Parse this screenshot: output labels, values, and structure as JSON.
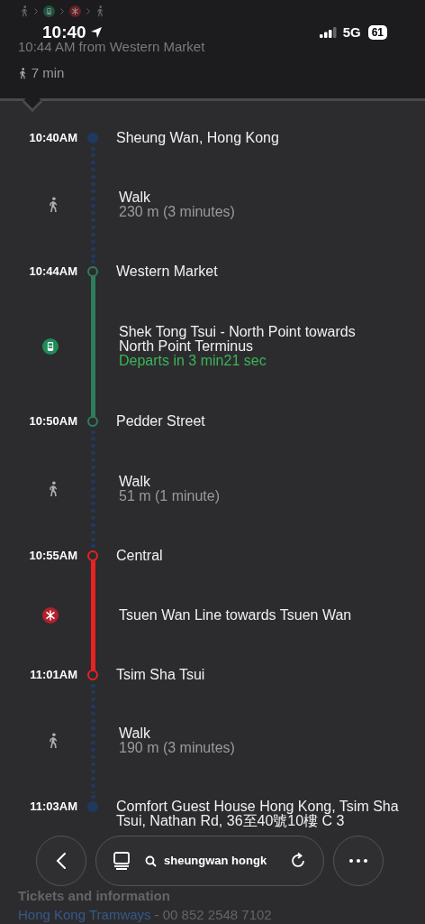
{
  "status_bar": {
    "time": "10:40",
    "network": "5G",
    "battery": "61"
  },
  "route_summary": {
    "modes": [
      {
        "kind": "walk"
      },
      {
        "kind": "tram"
      },
      {
        "kind": "mtr"
      },
      {
        "kind": "walk"
      }
    ],
    "departure": "10:44 AM from Western Market",
    "walk_time": "7 min"
  },
  "itinerary": [
    {
      "kind": "stop",
      "time": "10:40AM",
      "place": "Sheung Wan, Hong Kong"
    },
    {
      "kind": "walk",
      "color": "#1e3a5f",
      "title": "Walk",
      "detail": "230 m (3 minutes)"
    },
    {
      "kind": "stop",
      "time": "10:44AM",
      "place": "Western Market"
    },
    {
      "kind": "tram",
      "color": "#2e7d5b",
      "title": "Shek Tong Tsui - North Point towards North Point Terminus",
      "detail": "Departs in 3 min21 sec"
    },
    {
      "kind": "stop",
      "time": "10:50AM",
      "place": "Pedder Street"
    },
    {
      "kind": "walk",
      "color": "#1e3a5f",
      "title": "Walk",
      "detail": "51 m (1 minute)"
    },
    {
      "kind": "stop",
      "time": "10:55AM",
      "place": "Central"
    },
    {
      "kind": "mtr",
      "color": "#e8231f",
      "title": "Tsuen Wan Line towards Tsuen Wan"
    },
    {
      "kind": "stop",
      "time": "11:01AM",
      "place": "Tsim Sha Tsui"
    },
    {
      "kind": "walk",
      "color": "#1e3a5f",
      "title": "Walk",
      "detail": "190 m (3 minutes)"
    },
    {
      "kind": "stop",
      "time": "11:03AM",
      "place": "Comfort Guest House Hong Kong, Tsim Sha Tsui, Nathan Rd, 36至40號10樓 C 3"
    }
  ],
  "tickets": {
    "heading": "Tickets and information",
    "operator": "Hong Kong Tramways",
    "phone": "- 00 852 2548 7102"
  },
  "toolbar": {
    "search": "sheungwan hongk"
  }
}
